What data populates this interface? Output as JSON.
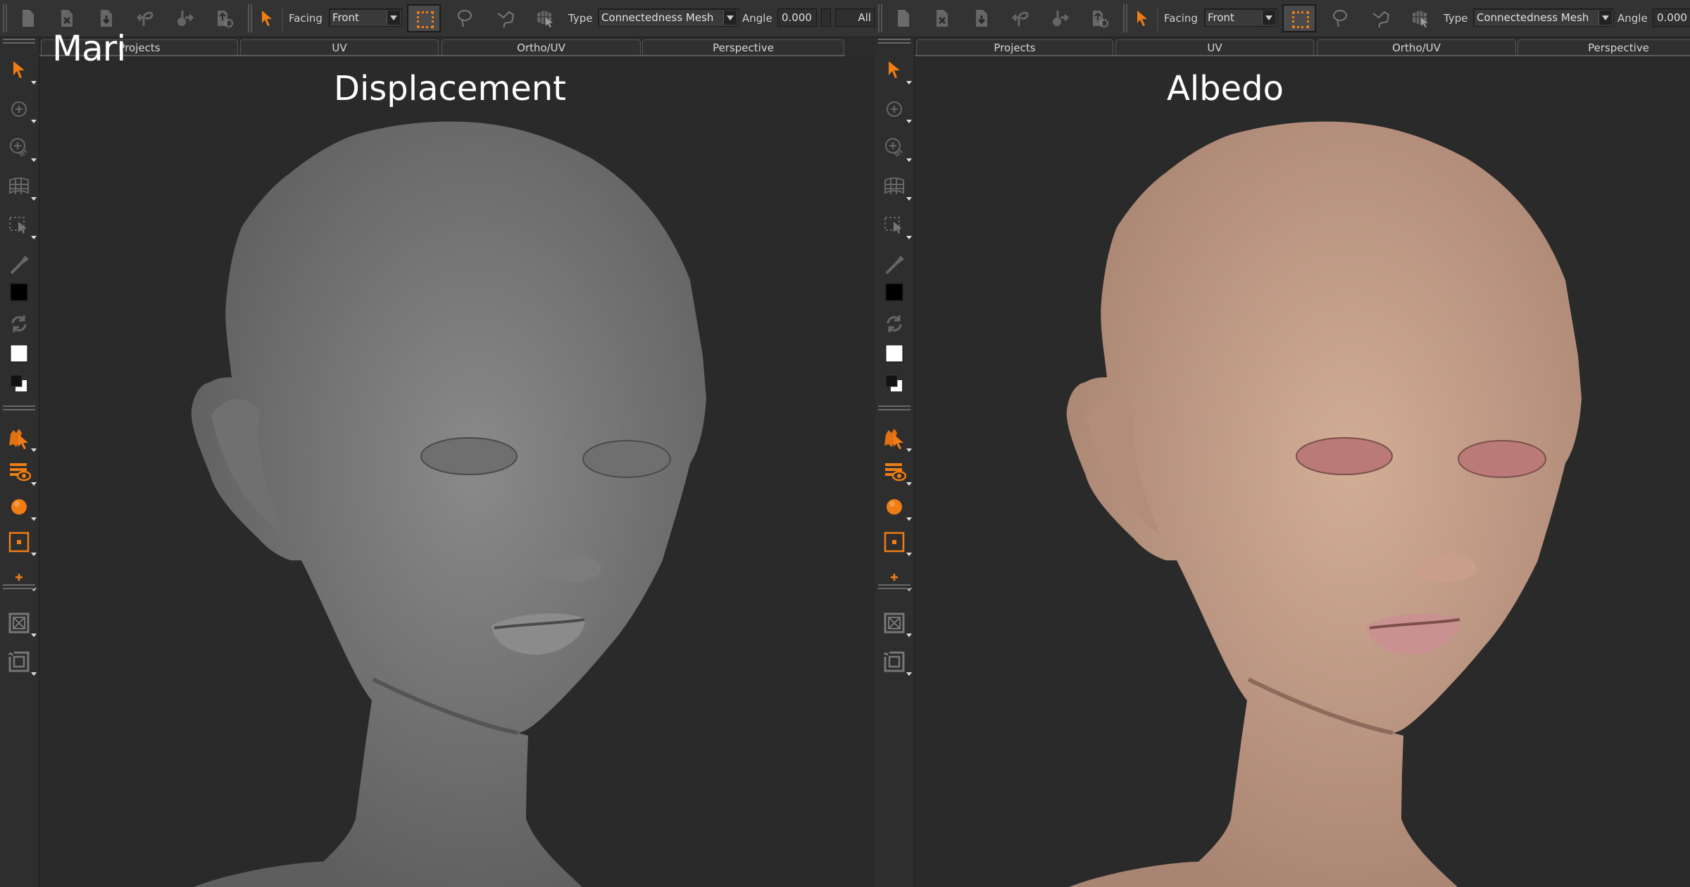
{
  "overlay_label": "Mari",
  "colors": {
    "accent": "#f07d14",
    "background": "#2a2a2a",
    "toolbar": "#333333",
    "displacement_skin": "#7a7a7a",
    "albedo_skin": "#c69e88",
    "albedo_eye_socket": "#b97a78"
  },
  "panels": [
    {
      "title": "Displacement",
      "toolbar": {
        "file_icons": [
          "new-file-icon",
          "close-file-icon",
          "import-file-icon",
          "export-icon",
          "share-icon",
          "project-settings-icon"
        ],
        "select_tool": "select-arrow-icon",
        "facing_label": "Facing",
        "facing_value": "Front",
        "marquee_tool": "marquee-select-icon",
        "lasso_tool": "lasso-select-icon",
        "polygon_tool": "polygon-lasso-icon",
        "mesh_select_tool": "mesh-select-icon",
        "type_label": "Type",
        "type_value": "Connectedness Mesh",
        "angle_label": "Angle",
        "angle_value": "0.000",
        "all_label": "All"
      },
      "tabs": [
        "Projects",
        "UV",
        "Ortho/UV",
        "Perspective"
      ],
      "active_tab": "Perspective"
    },
    {
      "title": "Albedo",
      "toolbar": {
        "file_icons": [
          "new-file-icon",
          "close-file-icon",
          "import-file-icon",
          "export-icon",
          "share-icon",
          "project-settings-icon"
        ],
        "select_tool": "select-arrow-icon",
        "facing_label": "Facing",
        "facing_value": "Front",
        "marquee_tool": "marquee-select-icon",
        "lasso_tool": "lasso-select-icon",
        "polygon_tool": "polygon-lasso-icon",
        "mesh_select_tool": "mesh-select-icon",
        "type_label": "Type",
        "type_value": "Connectedness Mesh",
        "angle_label": "Angle",
        "angle_value": "0.000"
      },
      "tabs": [
        "Projects",
        "UV",
        "Ortho/UV",
        "Perspective"
      ],
      "active_tab": "Perspective"
    }
  ],
  "sidebar_tools": [
    "select-tool",
    "paint-through-tool",
    "airbrush-tool",
    "patch-select-tool",
    "select-rect-tool",
    "eyedropper-tool",
    "foreground-color-swatch",
    "swap-colors-tool",
    "background-color-swatch",
    "default-colors-tool",
    "particle-select-tool",
    "layer-visibility-tool",
    "shader-sphere-tool",
    "object-center-tool",
    "add-point-tool",
    "frame-all-tool",
    "frame-selection-tool"
  ]
}
